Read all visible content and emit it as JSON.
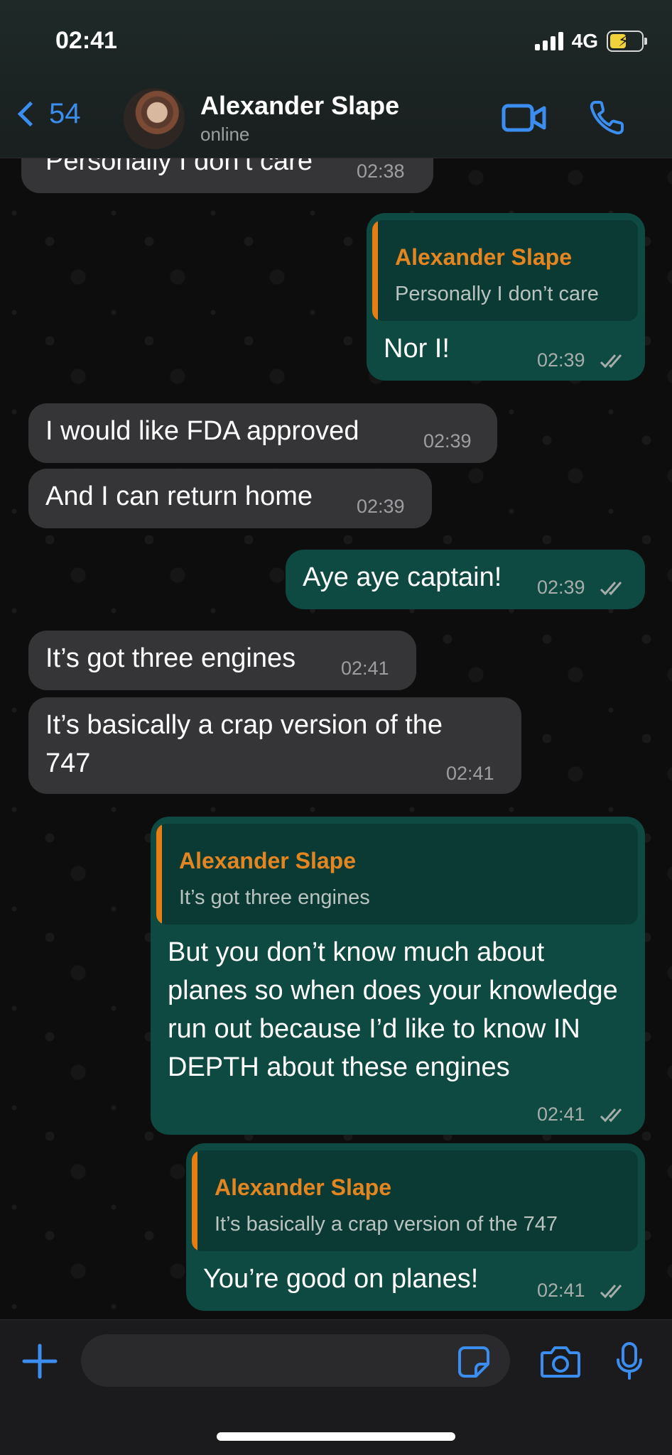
{
  "status_bar": {
    "time": "02:41",
    "network": "4G"
  },
  "header": {
    "back_count": "54",
    "contact_name": "Alexander Slape",
    "contact_status": "online"
  },
  "messages": [
    {
      "dir": "in",
      "text": "Personally I don’t care",
      "time": "02:38"
    },
    {
      "dir": "out",
      "quote_name": "Alexander Slape",
      "quote_text": "Personally I don’t care",
      "text": "Nor I!",
      "time": "02:39"
    },
    {
      "dir": "in",
      "text": "I would like FDA approved",
      "time": "02:39"
    },
    {
      "dir": "in",
      "text": "And I can return home",
      "time": "02:39"
    },
    {
      "dir": "out",
      "text": "Aye aye captain!",
      "time": "02:39"
    },
    {
      "dir": "in",
      "text": "It’s got three engines",
      "time": "02:41"
    },
    {
      "dir": "in",
      "text": "It’s basically a crap version of the 747",
      "time": "02:41"
    },
    {
      "dir": "out",
      "quote_name": "Alexander Slape",
      "quote_text": "It’s got three engines",
      "text": "But you don’t know much about planes so when does your knowledge run out because I’d like to know IN DEPTH about these engines",
      "time": "02:41"
    },
    {
      "dir": "out",
      "quote_name": "Alexander Slape",
      "quote_text": "It’s basically a crap version of the 747",
      "text": "You’re good on planes!",
      "time": "02:41"
    }
  ],
  "composer": {
    "placeholder": ""
  },
  "colors": {
    "accent": "#3b8ef0",
    "outgoing": "#0e4a41",
    "incoming": "#353538",
    "quote_name": "#e38520"
  }
}
